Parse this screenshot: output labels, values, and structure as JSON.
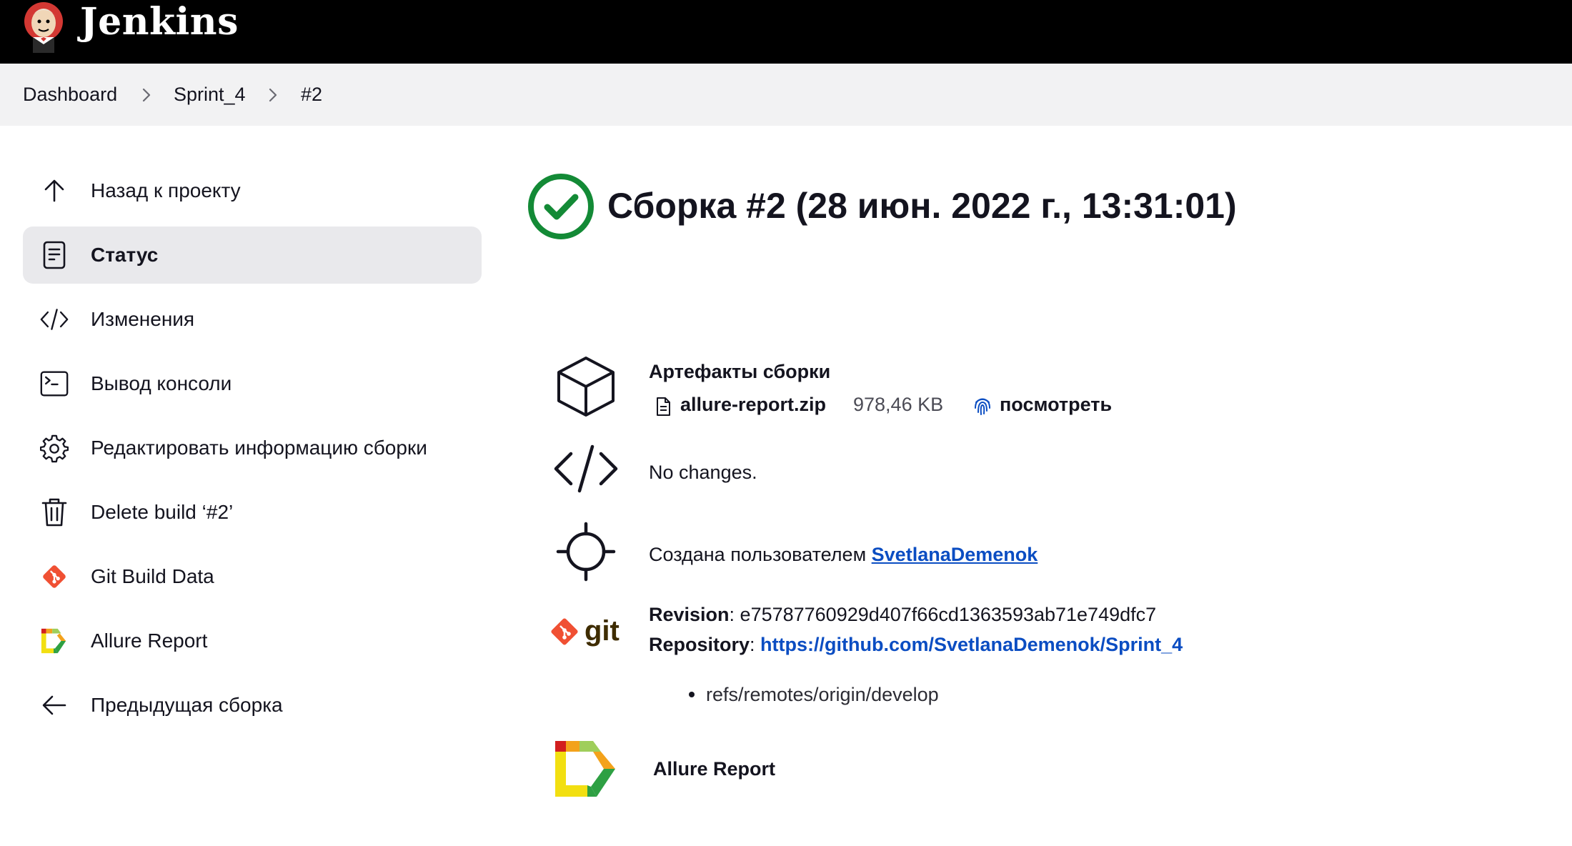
{
  "app": {
    "name": "Jenkins"
  },
  "breadcrumb": [
    "Dashboard",
    "Sprint_4",
    "#2"
  ],
  "sidebar": {
    "items": [
      {
        "label": "Назад к проекту",
        "icon": "arrow-up-icon"
      },
      {
        "label": "Статус",
        "icon": "document-icon",
        "active": true
      },
      {
        "label": "Изменения",
        "icon": "code-icon"
      },
      {
        "label": "Вывод консоли",
        "icon": "terminal-icon"
      },
      {
        "label": "Редактировать информацию сборки",
        "icon": "gear-icon"
      },
      {
        "label": "Delete build ‘#2’",
        "icon": "trash-icon"
      },
      {
        "label": "Git Build Data",
        "icon": "git-icon"
      },
      {
        "label": "Allure Report",
        "icon": "allure-icon"
      },
      {
        "label": "Предыдущая сборка",
        "icon": "arrow-left-icon"
      }
    ]
  },
  "main": {
    "title": "Сборка #2 (28 июн. 2022 г., 13:31:01)",
    "status": "success",
    "artifacts": {
      "heading": "Артефакты сборки",
      "file_name": "allure-report.zip",
      "file_size": "978,46 KB",
      "view_label": "посмотреть"
    },
    "changes": {
      "text": "No changes."
    },
    "cause": {
      "prefix": "Создана пользователем",
      "user": "SvetlanaDemenok"
    },
    "git": {
      "revision_label": "Revision",
      "revision_value": ": e75787760929d407f66cd1363593ab71e749dfc7",
      "repository_label": "Repository",
      "repository_sep": ": ",
      "repository_url": "https://github.com/SvetlanaDemenok/Sprint_4",
      "branches": [
        "refs/remotes/origin/develop"
      ],
      "logo_text": "git"
    },
    "allure": {
      "label": "Allure Report"
    }
  },
  "colors": {
    "header_bg": "#000000",
    "breadcrumb_bg": "#f2f2f3",
    "link": "#0b4dc2",
    "success": "#138a36",
    "git_orange": "#f05033",
    "git_brown": "#3e2c00"
  }
}
